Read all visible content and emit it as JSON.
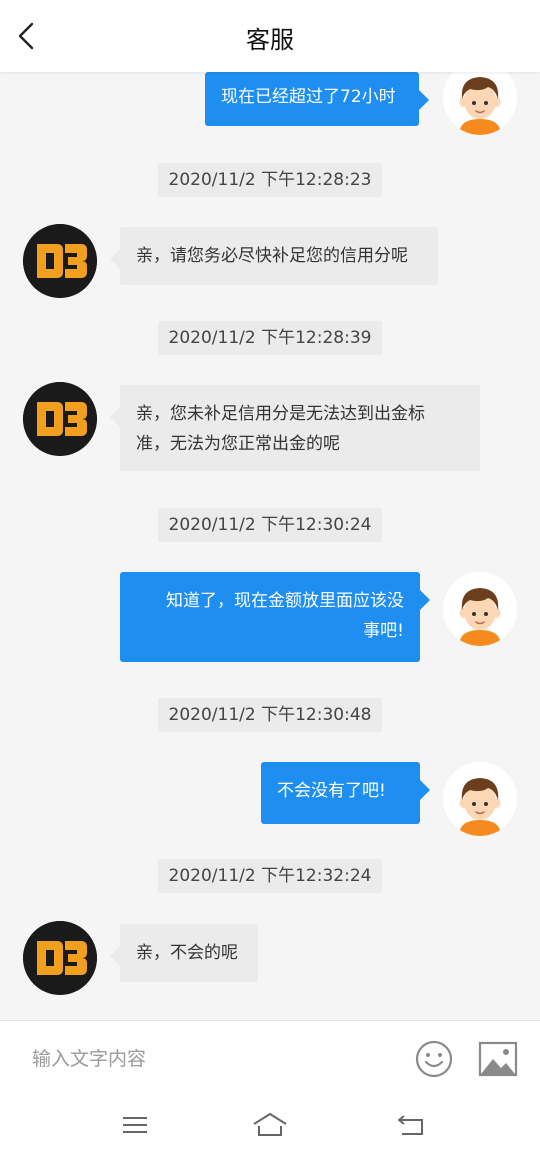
{
  "header": {
    "title": "客服"
  },
  "messages": [
    {
      "side": "right",
      "text": "现在已经超过了72小时"
    },
    {
      "time": "2020/11/2 下午12:28:23"
    },
    {
      "side": "left",
      "text": "亲，请您务必尽快补足您的信用分呢"
    },
    {
      "time": "2020/11/2 下午12:28:39"
    },
    {
      "side": "left",
      "line1": "亲，您未补足信用分是无法达到出金标",
      "line2": "准，无法为您正常出金的呢"
    },
    {
      "time": "2020/11/2 下午12:30:24"
    },
    {
      "side": "right",
      "line1": "知道了，现在金额放里面应该没",
      "line2": "事吧!"
    },
    {
      "time": "2020/11/2 下午12:30:48"
    },
    {
      "side": "right",
      "text": "不会没有了吧!"
    },
    {
      "time": "2020/11/2 下午12:32:24"
    },
    {
      "side": "left",
      "text": "亲，不会的呢"
    }
  ],
  "input": {
    "placeholder": "输入文字内容",
    "value": ""
  },
  "icons": {
    "back": "chevron-left-icon",
    "emoji": "smiley-icon",
    "image": "image-icon",
    "nav_menu": "menu-icon",
    "nav_home": "home-icon",
    "nav_back": "return-icon"
  },
  "colors": {
    "bubble_user": "#1e8ff0",
    "bubble_agent": "#ebebeb",
    "logo_orange": "#f0a01e",
    "avatar_dark": "#1a1a1a"
  }
}
